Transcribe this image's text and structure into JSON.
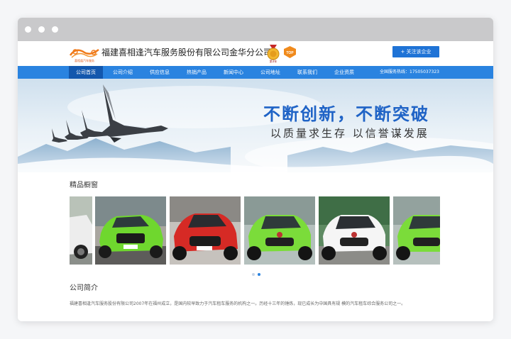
{
  "brand": {
    "logo_caption": "喜相逢汽车服务",
    "company_name": "福建喜相逢汽车服务股份有限公司金华分公司",
    "medal_caption": "第3年",
    "top_badge": "TOP",
    "follow_button": "+ 关注该企业",
    "accent_color": "#2a83e0"
  },
  "nav": {
    "items": [
      {
        "label": "公司首页",
        "active": true
      },
      {
        "label": "公司介绍",
        "active": false
      },
      {
        "label": "供应信息",
        "active": false
      },
      {
        "label": "热销产品",
        "active": false
      },
      {
        "label": "新闻中心",
        "active": false
      },
      {
        "label": "公司地址",
        "active": false
      },
      {
        "label": "联系我们",
        "active": false
      },
      {
        "label": "企业资质",
        "active": false
      }
    ],
    "hotline": "全国服务热线：17505037323"
  },
  "banner": {
    "slogan_main": "不断创新，不断突破",
    "slogan_sub": "以质量求生存  以信誉谋发展"
  },
  "showcase": {
    "title": "精品橱窗",
    "slides": [
      {
        "color": "#f2f2f2",
        "kind": "white-suv-partial"
      },
      {
        "color": "#6fd72e",
        "kind": "green-audi"
      },
      {
        "color": "#d62a25",
        "kind": "red-sedan"
      },
      {
        "color": "#7bdc3a",
        "kind": "green-mg"
      },
      {
        "color": "#f5f5f5",
        "kind": "white-mg"
      },
      {
        "color": "#7bdc3a",
        "kind": "green-mg-partial"
      }
    ],
    "dots": [
      false,
      true
    ]
  },
  "intro": {
    "title": "公司简介",
    "text": "福建喜相逢汽车服务股份有限公司2007年在福州成立，是国内较早致力于汽车租车服务的机构之一。历经十三年的锤炼，现已成长为中国具有规 模的汽车租车综合服务公司之一。"
  }
}
